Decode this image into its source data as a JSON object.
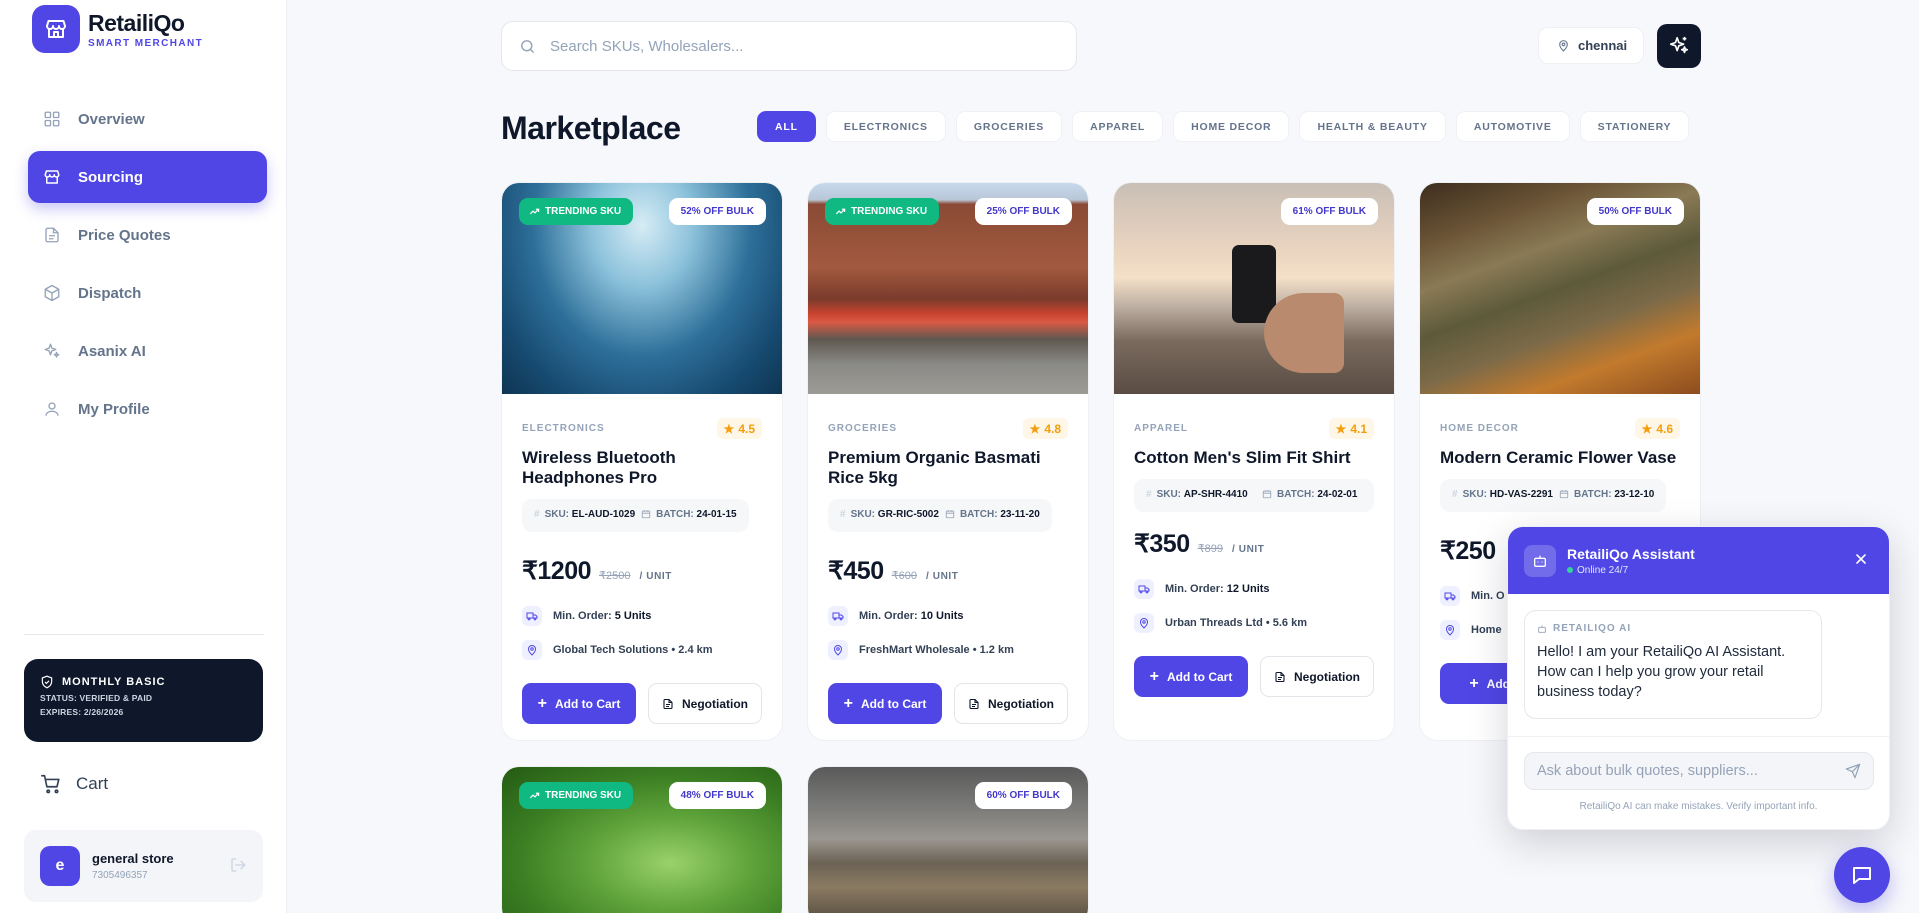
{
  "brand": {
    "name": "RetailiQo",
    "tagline": "SMART MERCHANT"
  },
  "sidebar": {
    "items": [
      {
        "label": "Overview",
        "icon": "grid-icon",
        "active": false
      },
      {
        "label": "Sourcing",
        "icon": "store-icon",
        "active": true
      },
      {
        "label": "Price Quotes",
        "icon": "document-icon",
        "active": false
      },
      {
        "label": "Dispatch",
        "icon": "box-icon",
        "active": false
      },
      {
        "label": "Asanix AI",
        "icon": "sparkles-icon",
        "active": false
      },
      {
        "label": "My Profile",
        "icon": "user-icon",
        "active": false
      }
    ],
    "plan": {
      "title": "MONTHLY BASIC",
      "status": "STATUS: VERIFIED & PAID",
      "expires": "EXPIRES: 2/26/2026"
    },
    "cart_label": "Cart",
    "user": {
      "initial": "e",
      "name": "general store",
      "phone": "7305496357"
    }
  },
  "search": {
    "placeholder": "Search SKUs, Wholesalers..."
  },
  "location": {
    "city": "chennai"
  },
  "page": {
    "title": "Marketplace"
  },
  "categories": [
    "ALL",
    "ELECTRONICS",
    "GROCERIES",
    "APPAREL",
    "HOME DECOR",
    "HEALTH & BEAUTY",
    "AUTOMOTIVE",
    "STATIONERY"
  ],
  "active_category": "ALL",
  "products": [
    {
      "trending": "TRENDING SKU",
      "discount": "52% OFF BULK",
      "category": "ELECTRONICS",
      "rating": "4.5",
      "name": "Wireless Bluetooth Headphones Pro",
      "sku_label": "SKU:",
      "sku": "EL-AUD-1029",
      "batch_label": "BATCH:",
      "batch": "24-01-15",
      "price": "₹1200",
      "old_price": "₹2500",
      "unit": "/ UNIT",
      "min_order_label": "Min. Order:",
      "min_order": "5 Units",
      "supplier": "Global Tech Solutions • 2.4 km",
      "cart_label": "Add to Cart",
      "negotiate_label": "Negotiation"
    },
    {
      "trending": "TRENDING SKU",
      "discount": "25% OFF BULK",
      "category": "GROCERIES",
      "rating": "4.8",
      "name": "Premium Organic Basmati Rice 5kg",
      "sku_label": "SKU:",
      "sku": "GR-RIC-5002",
      "batch_label": "BATCH:",
      "batch": "23-11-20",
      "price": "₹450",
      "old_price": "₹600",
      "unit": "/ UNIT",
      "min_order_label": "Min. Order:",
      "min_order": "10 Units",
      "supplier": "FreshMart Wholesale • 1.2 km",
      "cart_label": "Add to Cart",
      "negotiate_label": "Negotiation"
    },
    {
      "trending": "",
      "discount": "61% OFF BULK",
      "category": "APPAREL",
      "rating": "4.1",
      "name": "Cotton Men's Slim Fit Shirt",
      "sku_label": "SKU:",
      "sku": "AP-SHR-4410",
      "batch_label": "BATCH:",
      "batch": "24-02-01",
      "price": "₹350",
      "old_price": "₹899",
      "unit": "/ UNIT",
      "min_order_label": "Min. Order:",
      "min_order": "12 Units",
      "supplier": "Urban Threads Ltd • 5.6 km",
      "cart_label": "Add to Cart",
      "negotiate_label": "Negotiation"
    },
    {
      "trending": "",
      "discount": "50% OFF BULK",
      "category": "HOME DECOR",
      "rating": "4.6",
      "name": "Modern Ceramic Flower Vase",
      "sku_label": "SKU:",
      "sku": "HD-VAS-2291",
      "batch_label": "BATCH:",
      "batch": "23-12-10",
      "price": "₹250",
      "old_price": "",
      "unit": "",
      "min_order_label": "Min. O",
      "min_order": "",
      "supplier": "Home",
      "cart_label": "Add to",
      "negotiate_label": ""
    },
    {
      "trending": "TRENDING SKU",
      "discount": "48% OFF BULK"
    },
    {
      "trending": "",
      "discount": "60% OFF BULK"
    }
  ],
  "chat": {
    "title": "RetailiQo Assistant",
    "status": "Online 24/7",
    "tag": "RETAILIQO AI",
    "message": "Hello! I am your RetailiQo AI Assistant. How can I help you grow your retail business today?",
    "placeholder": "Ask about bulk quotes, suppliers...",
    "disclaimer": "RetailiQo AI can make mistakes. Verify important info."
  },
  "colors": {
    "accent": "#5046e5",
    "success": "#10b981",
    "dark": "#0f172a",
    "star": "#f59e0b"
  }
}
